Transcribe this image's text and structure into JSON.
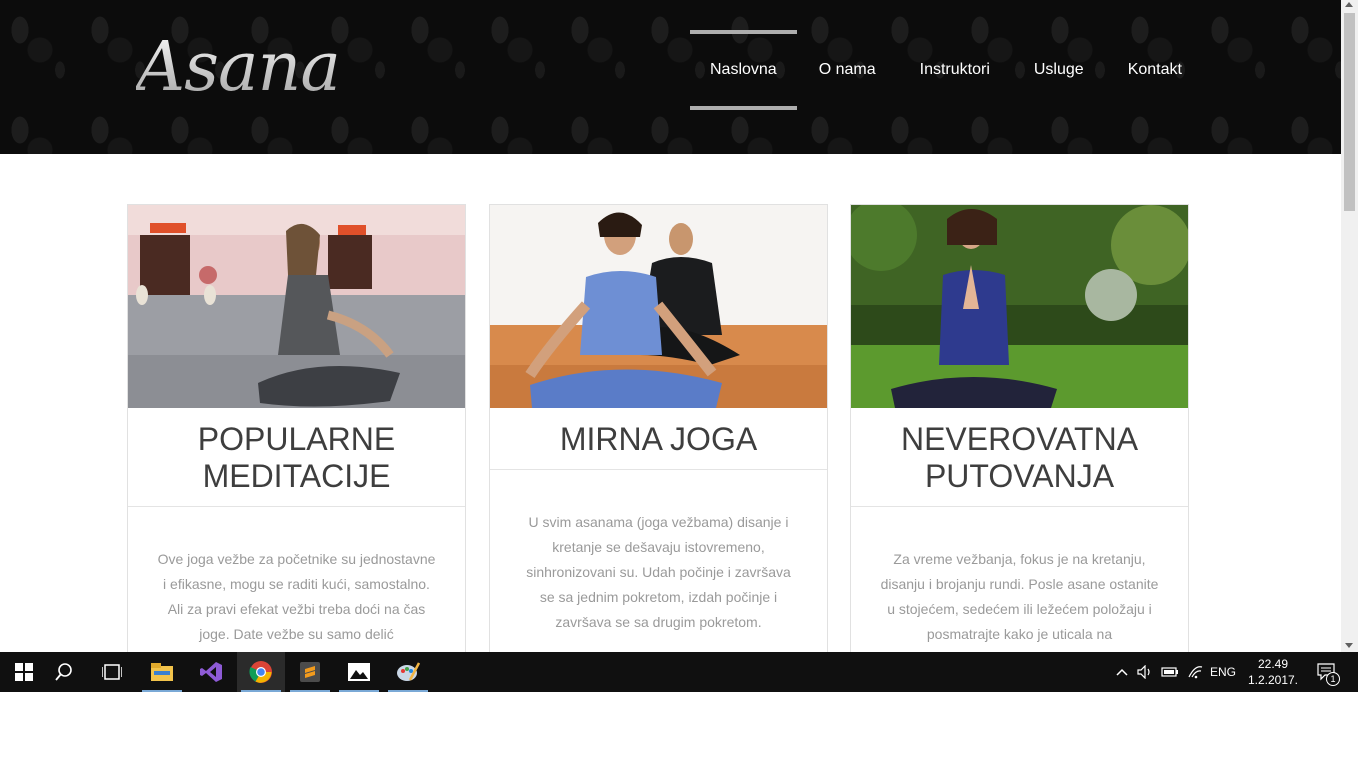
{
  "header": {
    "logo_text": "Asana",
    "nav": [
      {
        "label": "Naslovna",
        "active": true
      },
      {
        "label": "O nama",
        "active": false
      },
      {
        "label": "Instruktori",
        "active": false
      },
      {
        "label": "Usluge",
        "active": false
      },
      {
        "label": "Kontakt",
        "active": false
      }
    ]
  },
  "cards": [
    {
      "title": "POPULARNE MEDITACIJE",
      "text": "Ove joga vežbe za početnike su jednostavne i efikasne, mogu se raditi kući, samostalno. Ali za pravi efekat vežbi treba doći na čas joge. Date vežbe su samo delić"
    },
    {
      "title": "MIRNA JOGA",
      "text": "U svim asanama (joga vežbama) disanje i kretanje se dešavaju istovremeno, sinhronizovani su. Udah počinje i završava se sa jednim pokretom, izdah počinje i završava se sa drugim pokretom."
    },
    {
      "title": "NEVEROVATNA PUTOVANJA",
      "text": "Za vreme vežbanja, fokus je na kretanju, disanju i brojanju rundi. Posle asane ostanite u stojećem, sedećem ili ležećem položaju i posmatrajte kako je uticala na"
    }
  ],
  "taskbar": {
    "apps": [
      "windows-start-icon",
      "search-icon",
      "task-view-icon",
      "file-explorer-icon",
      "visual-studio-icon",
      "chrome-icon",
      "sublime-text-icon",
      "photos-icon",
      "paint-icon"
    ],
    "tray": {
      "language": "ENG",
      "time": "22.49",
      "date": "1.2.2017.",
      "notification_count": "1"
    }
  },
  "colors": {
    "header_bg": "#0c0c0c",
    "nav_active_bar": "#aeaeae",
    "title": "#3e3e3e",
    "body_text": "#9a9a9a",
    "taskbar_bg": "#101010"
  }
}
